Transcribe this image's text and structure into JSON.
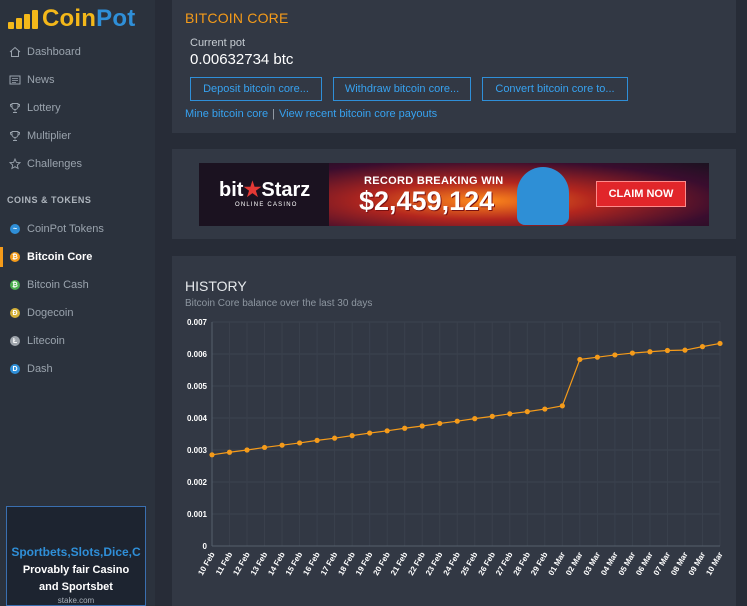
{
  "logo": {
    "coin": "Coin",
    "pot": "Pot"
  },
  "nav": [
    {
      "label": "Dashboard",
      "icon": "home-icon"
    },
    {
      "label": "News",
      "icon": "news-icon"
    },
    {
      "label": "Lottery",
      "icon": "trophy-icon"
    },
    {
      "label": "Multiplier",
      "icon": "trophy-icon"
    },
    {
      "label": "Challenges",
      "icon": "star-icon"
    }
  ],
  "coins_section_title": "COINS & TOKENS",
  "coins": [
    {
      "label": "CoinPot Tokens",
      "color": "#2f8fd8",
      "active": false
    },
    {
      "label": "Bitcoin Core",
      "color": "#f59b1a",
      "active": true
    },
    {
      "label": "Bitcoin Cash",
      "color": "#4caf50",
      "active": false
    },
    {
      "label": "Dogecoin",
      "color": "#d4b13a",
      "active": false
    },
    {
      "label": "Litecoin",
      "color": "#9ea4ab",
      "active": false
    },
    {
      "label": "Dash",
      "color": "#2f8fd8",
      "active": false
    }
  ],
  "sidebar_ad": {
    "line1": "Sportbets,Slots,Dice,C",
    "line2": "Provably fair Casino",
    "line3": "and Sportsbet",
    "line4": "stake.com"
  },
  "main": {
    "title": "BITCOIN CORE",
    "pot_label": "Current pot",
    "pot_value": "0.00632734 btc",
    "buttons": {
      "deposit": "Deposit bitcoin core...",
      "withdraw": "Withdraw bitcoin core...",
      "convert": "Convert bitcoin core to..."
    },
    "links": {
      "mine": "Mine bitcoin core",
      "separator": "|",
      "payouts": "View recent bitcoin core payouts"
    }
  },
  "banner": {
    "brand_left": "bit",
    "brand_star": "★",
    "brand_right": "Starz",
    "brand_sub": "ONLINE CASINO",
    "headline": "RECORD BREAKING WIN",
    "amount": "$2,459,124",
    "cta": "CLAIM NOW"
  },
  "history": {
    "title": "HISTORY",
    "subtitle": "Bitcoin Core balance over the last 30 days"
  },
  "chart_data": {
    "type": "line",
    "x": [
      "10 Feb",
      "11 Feb",
      "12 Feb",
      "13 Feb",
      "14 Feb",
      "15 Feb",
      "16 Feb",
      "17 Feb",
      "18 Feb",
      "19 Feb",
      "20 Feb",
      "21 Feb",
      "22 Feb",
      "23 Feb",
      "24 Feb",
      "25 Feb",
      "26 Feb",
      "27 Feb",
      "28 Feb",
      "29 Feb",
      "01 Mar",
      "02 Mar",
      "03 Mar",
      "04 Mar",
      "05 Mar",
      "06 Mar",
      "07 Mar",
      "08 Mar",
      "09 Mar",
      "10 Mar"
    ],
    "series": [
      {
        "values": [
          0.00285,
          0.00293,
          0.003,
          0.00308,
          0.00315,
          0.00322,
          0.0033,
          0.00337,
          0.00345,
          0.00353,
          0.0036,
          0.00368,
          0.00375,
          0.00383,
          0.0039,
          0.00398,
          0.00405,
          0.00413,
          0.0042,
          0.00428,
          0.00438,
          0.00583,
          0.0059,
          0.00597,
          0.00603,
          0.00607,
          0.00611,
          0.00612,
          0.00623,
          0.00633
        ]
      }
    ],
    "ylim": [
      0,
      0.007
    ],
    "yticks": [
      "0",
      "0.001",
      "0.002",
      "0.003",
      "0.004",
      "0.005",
      "0.006",
      "0.007"
    ],
    "grid": true,
    "line_color": "#f59b1a"
  }
}
